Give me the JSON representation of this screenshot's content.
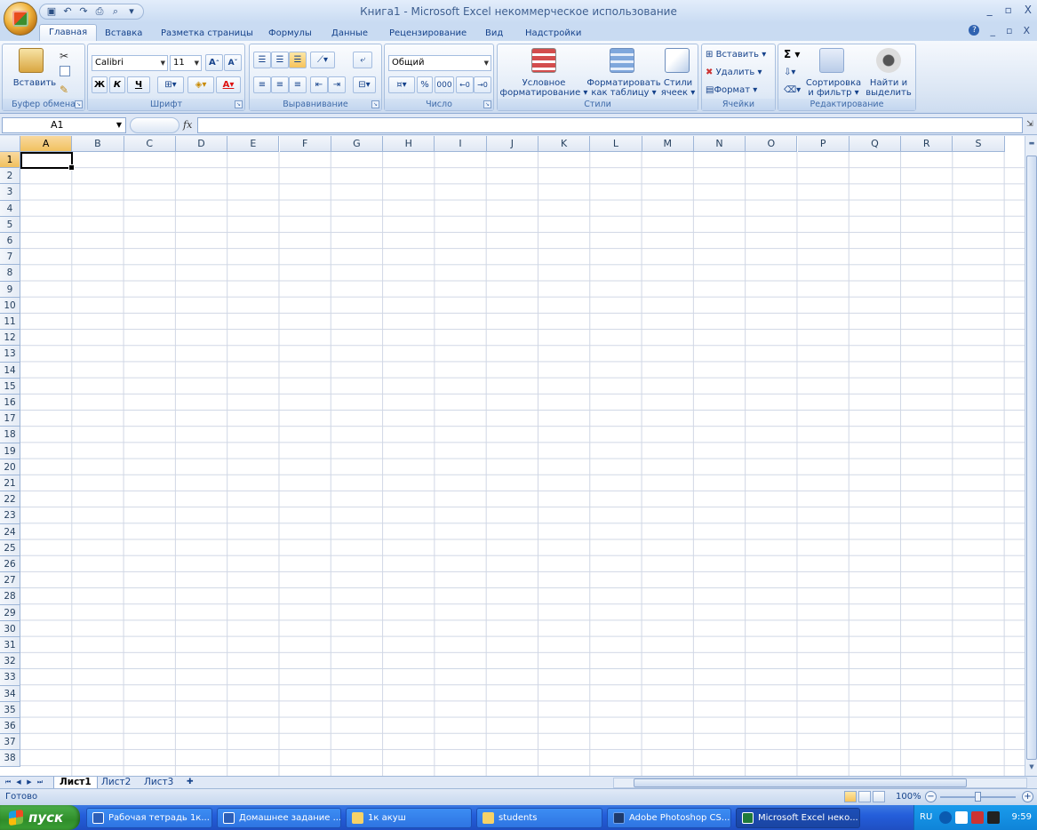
{
  "window": {
    "title": "Книга1 - Microsoft Excel некоммерческое использование",
    "controls": [
      "_",
      "▫",
      "X"
    ],
    "doc_controls": [
      "_",
      "▫",
      "X"
    ]
  },
  "quick_access": {
    "icons": [
      "save-icon",
      "undo-icon",
      "redo-icon",
      "print-icon",
      "print-preview-icon",
      "customize-icon"
    ]
  },
  "tabs": [
    {
      "label": "Главная",
      "active": true
    },
    {
      "label": "Вставка"
    },
    {
      "label": "Разметка страницы"
    },
    {
      "label": "Формулы"
    },
    {
      "label": "Данные"
    },
    {
      "label": "Рецензирование"
    },
    {
      "label": "Вид"
    },
    {
      "label": "Надстройки"
    }
  ],
  "ribbon": {
    "clipboard": {
      "label": "Буфер обмена",
      "paste": "Вставить"
    },
    "font": {
      "label": "Шрифт",
      "name": "Calibri",
      "size": "11",
      "bold": "Ж",
      "italic": "К",
      "underline": "Ч",
      "grow": "A",
      "shrink": "A"
    },
    "alignment": {
      "label": "Выравнивание"
    },
    "number": {
      "label": "Число",
      "format": "Общий",
      "percent": "%",
      "thousands": "000"
    },
    "styles": {
      "label": "Стили",
      "conditional_line1": "Условное",
      "conditional_line2": "форматирование",
      "table_line1": "Форматировать",
      "table_line2": "как таблицу",
      "cell_line1": "Стили",
      "cell_line2": "ячеек"
    },
    "cells": {
      "label": "Ячейки",
      "insert": "Вставить",
      "delete": "Удалить",
      "format": "Формат"
    },
    "editing": {
      "label": "Редактирование",
      "sum": "Σ",
      "sort_line1": "Сортировка",
      "sort_line2": "и фильтр",
      "find_line1": "Найти и",
      "find_line2": "выделить"
    }
  },
  "formula_bar": {
    "name_box": "A1",
    "fx": "fx",
    "value": ""
  },
  "grid": {
    "columns": [
      "A",
      "B",
      "C",
      "D",
      "E",
      "F",
      "G",
      "H",
      "I",
      "J",
      "K",
      "L",
      "M",
      "N",
      "O",
      "P",
      "Q",
      "R",
      "S"
    ],
    "rows": [
      "1",
      "2",
      "3",
      "4",
      "5",
      "6",
      "7",
      "8",
      "9",
      "10",
      "11",
      "12",
      "13",
      "14",
      "15",
      "16",
      "17",
      "18",
      "19",
      "20",
      "21",
      "22",
      "23",
      "24",
      "25",
      "26",
      "27",
      "28",
      "29",
      "30",
      "31",
      "32",
      "33",
      "34",
      "35",
      "36",
      "37",
      "38"
    ],
    "selected_cell": "A1"
  },
  "sheets": [
    {
      "label": "Лист1",
      "active": true
    },
    {
      "label": "Лист2"
    },
    {
      "label": "Лист3"
    }
  ],
  "status": {
    "text": "Готово",
    "zoom": "100%",
    "zoom_minus": "−",
    "zoom_plus": "+"
  },
  "taskbar": {
    "start": "пуск",
    "tasks": [
      {
        "label": "Рабочая тетрадь 1к...",
        "icon": "word-doc-icon"
      },
      {
        "label": "Домашнее задание ...",
        "icon": "word-doc-icon"
      },
      {
        "label": "1к акуш",
        "icon": "folder-icon"
      },
      {
        "label": "students",
        "icon": "folder-icon"
      },
      {
        "label": "Adobe Photoshop CS...",
        "icon": "photoshop-icon"
      },
      {
        "label": "Microsoft Excel неко...",
        "icon": "excel-icon",
        "active": true
      }
    ],
    "lang": "RU",
    "clock": "9:59"
  },
  "colors": {
    "accent": "#15428b",
    "ribbon": "#dbe6f4",
    "selection": "#f1c15f",
    "taskbar": "#245edb",
    "start": "#3b9f35"
  }
}
